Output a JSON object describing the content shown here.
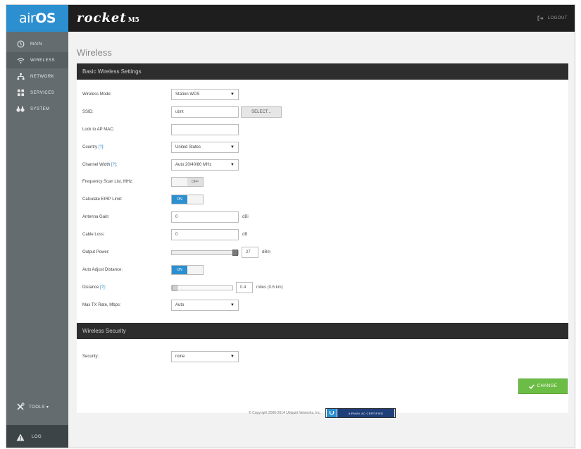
{
  "app": {
    "logo_air": "air",
    "logo_os": "OS",
    "brand": "rocket",
    "brand_sub": "M5"
  },
  "topbar": {
    "logout_label": "LOGOUT"
  },
  "sidebar": {
    "items": [
      {
        "label": "MAIN",
        "icon": "dashboard-icon"
      },
      {
        "label": "WIRELESS",
        "icon": "wifi-icon"
      },
      {
        "label": "NETWORK",
        "icon": "network-icon"
      },
      {
        "label": "SERVICES",
        "icon": "services-icon"
      },
      {
        "label": "SYSTEM",
        "icon": "system-icon"
      }
    ],
    "tools_label": "TOOLS ▾",
    "log_label": "LOG"
  },
  "page": {
    "title": "Wireless"
  },
  "basic": {
    "header": "Basic Wireless Settings",
    "wireless_mode": {
      "label": "Wireless Mode:",
      "value": "Station WDS"
    },
    "ssid": {
      "label": "SSID:",
      "value": "ubnt",
      "select_label": "SELECT..."
    },
    "lock_ap": {
      "label": "Lock to AP MAC:",
      "value": ""
    },
    "country": {
      "label": "Country",
      "help": "[?]",
      "suffix": ":",
      "value": "United States"
    },
    "channel_width": {
      "label": "Channel Width",
      "help": "[?]",
      "suffix": ":",
      "value": "Auto 20/40/80 MHz"
    },
    "freq_scan": {
      "label": "Frequency Scan List, MHz:",
      "state": "OFF"
    },
    "calc_eirp": {
      "label": "Calculate EIRP Limit:",
      "state": "ON"
    },
    "antenna_gain": {
      "label": "Antenna Gain:",
      "value": "0",
      "unit": "dBi"
    },
    "cable_loss": {
      "label": "Cable Loss:",
      "value": "0",
      "unit": "dB"
    },
    "output_power": {
      "label": "Output Power:",
      "value": "27",
      "unit": "dBm",
      "level": 1.0
    },
    "auto_adjust": {
      "label": "Auto Adjust Distance:",
      "state": "ON"
    },
    "distance": {
      "label": "Distance",
      "help": "[?]",
      "suffix": ":",
      "value": "0.4",
      "unit": "miles (0.6 km)",
      "level": 0.0
    },
    "max_tx": {
      "label": "Max TX Rate, Mbps:",
      "value": "Auto"
    }
  },
  "security": {
    "header": "Wireless Security",
    "label": "Security:",
    "value": "none"
  },
  "actions": {
    "change_label": "CHANGE"
  },
  "footer": {
    "copyright": "© Copyright 2006-2014 Ubiquiti Networks, Inc.",
    "certified": "AIRMAX AC CERTIFIED"
  },
  "colors": {
    "accent": "#2c8fd0",
    "success": "#6cbd45",
    "sidebar": "#646c70",
    "topbar": "#1e1e1e"
  }
}
